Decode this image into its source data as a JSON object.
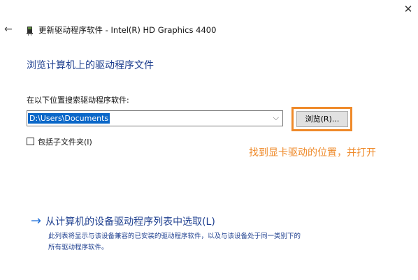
{
  "window": {
    "close_glyph": "✕",
    "back_glyph": "←",
    "title": "更新驱动程序软件 - Intel(R) HD Graphics 4400"
  },
  "main": {
    "heading": "浏览计算机上的驱动程序文件",
    "search_label": "在以下位置搜索驱动程序软件:",
    "path_value": "D:\\Users\\Documents",
    "dropdown_glyph": "⌵",
    "browse_label": "浏览(R)...",
    "include_subfolders_label": "包括子文件夹(I)",
    "include_subfolders_checked": false,
    "annotation": "找到显卡驱动的位置，并打开"
  },
  "pick": {
    "arrow_glyph": "→",
    "link_label": "从计算机的设备驱动程序列表中选取(L)",
    "desc_line1": "此列表将显示与该设备兼容的已安装的驱动程序软件，以及与该设备处于同一类别下的",
    "desc_line2": "所有驱动程序软件。"
  },
  "colors": {
    "link": "#1e3f8f",
    "highlight": "#ef8a2a",
    "selection": "#0a67c8"
  },
  "icons": {
    "close": "close-icon",
    "back": "back-arrow-icon",
    "device": "graphics-card-icon",
    "dropdown": "chevron-down-icon",
    "link_arrow": "arrow-right-icon"
  }
}
